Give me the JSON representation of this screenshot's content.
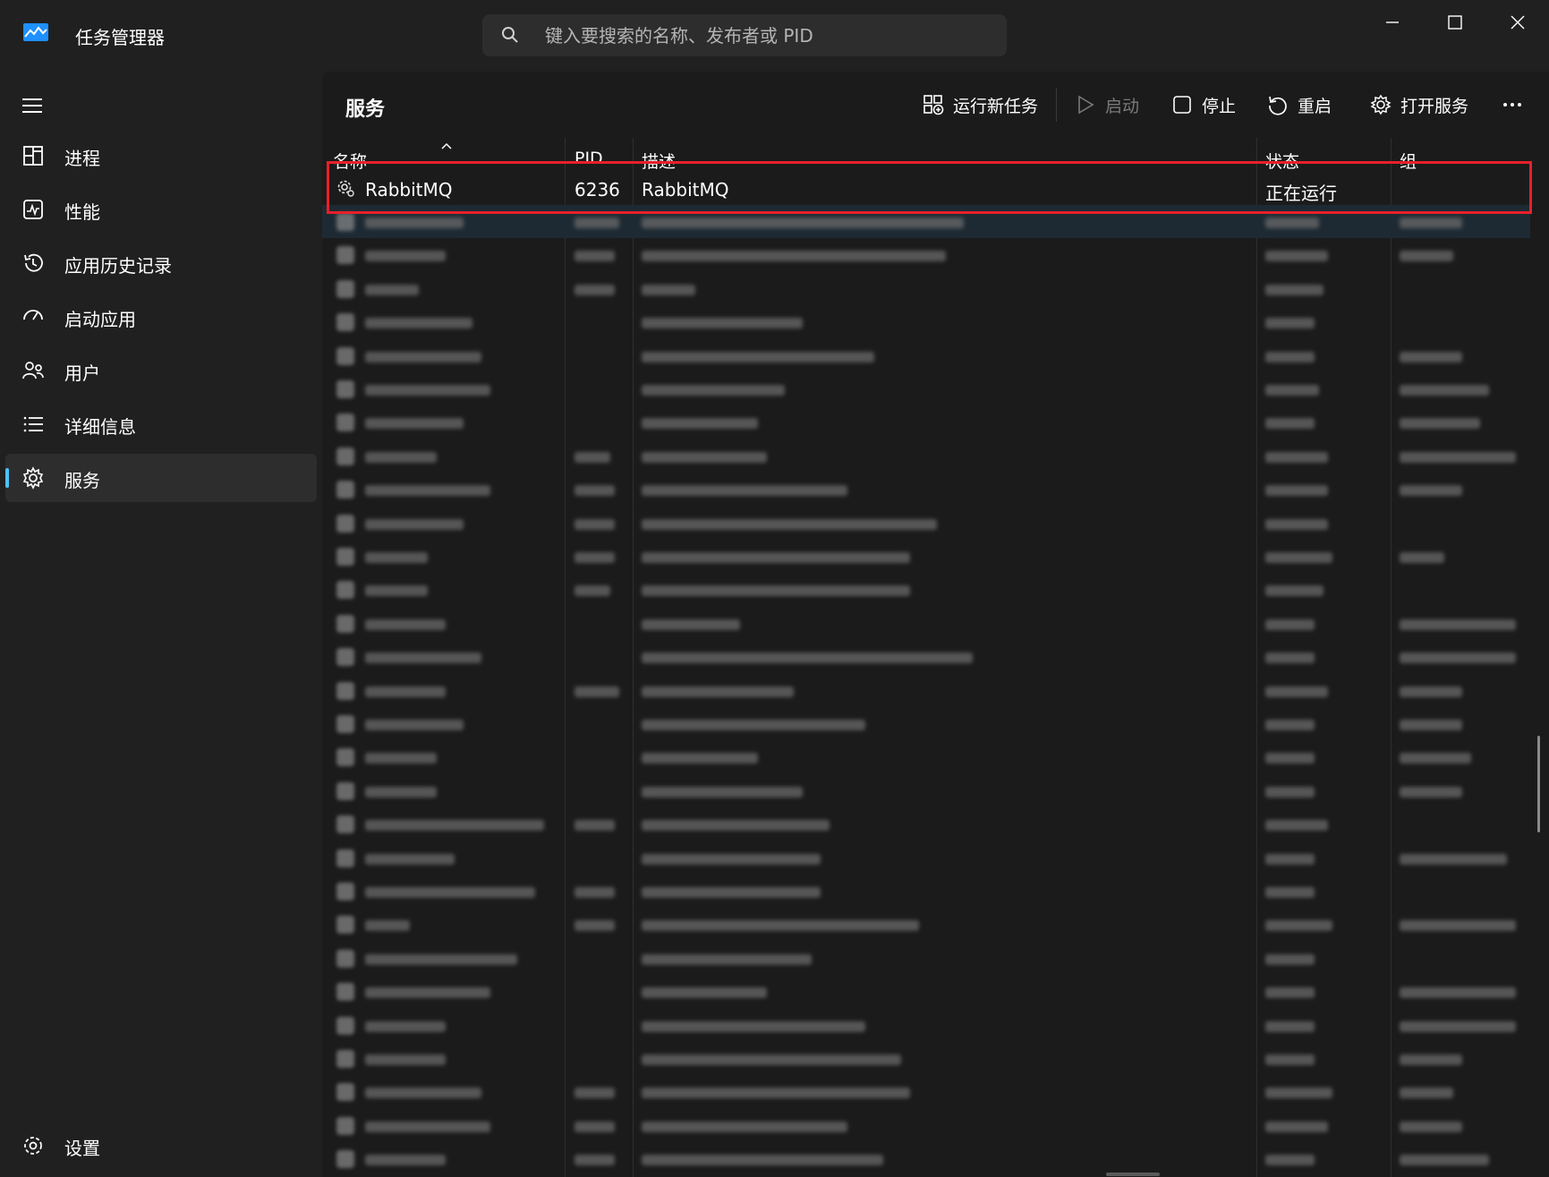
{
  "titlebar": {
    "app_title": "任务管理器",
    "search_placeholder": "键入要搜索的名称、发布者或 PID"
  },
  "sidebar": {
    "items": [
      {
        "label": "进程",
        "icon": "processes-icon"
      },
      {
        "label": "性能",
        "icon": "performance-icon"
      },
      {
        "label": "应用历史记录",
        "icon": "app-history-icon"
      },
      {
        "label": "启动应用",
        "icon": "startup-apps-icon"
      },
      {
        "label": "用户",
        "icon": "users-icon"
      },
      {
        "label": "详细信息",
        "icon": "details-icon"
      },
      {
        "label": "服务",
        "icon": "services-icon",
        "active": true
      }
    ],
    "settings_label": "设置"
  },
  "toolbar": {
    "page_title": "服务",
    "run_new_task": "运行新任务",
    "start": "启动",
    "stop": "停止",
    "restart": "重启",
    "open_services": "打开服务"
  },
  "table": {
    "columns": [
      "名称",
      "PID",
      "描述",
      "状态",
      "组"
    ],
    "highlighted_row": {
      "name": "RabbitMQ",
      "pid": "6236",
      "description": "RabbitMQ",
      "status": "正在运行",
      "group": ""
    }
  },
  "colors": {
    "accent": "#4cc2ff",
    "highlight_border": "#e8202a",
    "background": "#202020",
    "panel": "#1b1b1b"
  }
}
